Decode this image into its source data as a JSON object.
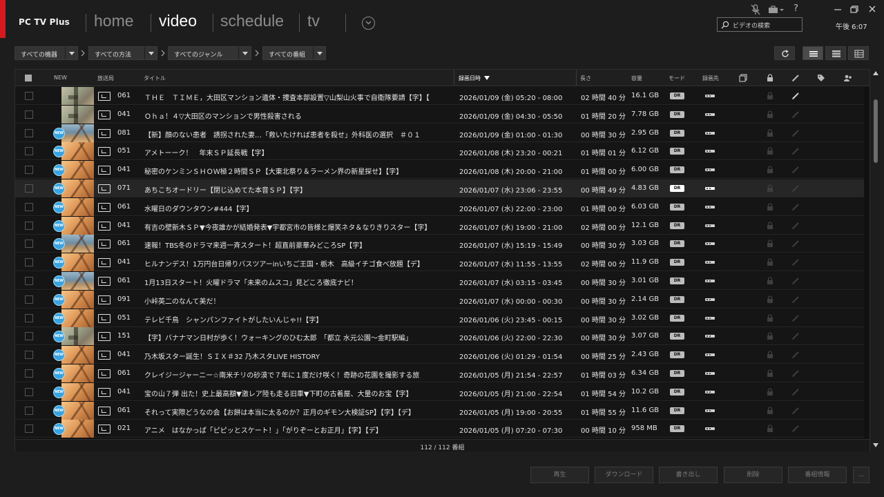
{
  "app": {
    "title": "PC TV Plus"
  },
  "nav": {
    "home": "home",
    "video": "video",
    "schedule": "schedule",
    "tv": "tv",
    "active": "video"
  },
  "window": {
    "help": "?"
  },
  "search": {
    "placeholder": "ビデオの検索"
  },
  "clock": "午後 6:07",
  "filters": {
    "device": "すべての機器",
    "method": "すべての方法",
    "genre": "すべてのジャンル",
    "program": "すべての番組"
  },
  "view": {
    "selected": "list"
  },
  "table": {
    "headers": {
      "new": "NEW",
      "station": "放送局",
      "title": "タイトル",
      "recorded": "録画日時",
      "length": "長さ",
      "size": "容量",
      "mode": "モード",
      "dest": "録画先"
    },
    "sort_column": "録画日時",
    "rows": [
      {
        "new": false,
        "thumb": "map",
        "ch": "061",
        "title": "ＴＨＥ　ＴＩＭＥ，大田区マンション遺体・捜査本部設置▽山梨山火事で自衛隊要請【字】【",
        "date": "2026/01/09 (金) 05:20 - 08:00",
        "length": "02 時間 40 分",
        "size": "16.1 GB",
        "mode": "DR",
        "editable": true
      },
      {
        "new": false,
        "thumb": "map",
        "ch": "041",
        "title": "Ｏｈａ！４▽大田区のマンションで男性殺害される",
        "date": "2026/01/09 (金) 04:30 - 05:50",
        "length": "01 時間 20 分",
        "size": "7.78 GB",
        "mode": "DR",
        "editable": false
      },
      {
        "new": true,
        "thumb": "blue",
        "ch": "081",
        "title": "【新】顔のない患者　誘拐された妻…「救いたければ患者を殺せ」外科医の選択　＃０１",
        "date": "2026/01/09 (金) 01:00 - 01:30",
        "length": "00 時間 30 分",
        "size": "2.95 GB",
        "mode": "DR",
        "editable": false
      },
      {
        "new": true,
        "thumb": "orange",
        "ch": "051",
        "title": "アメトーーク！　年末ＳＰ延長戦【字】",
        "date": "2026/01/08 (木) 23:20 - 00:21",
        "length": "01 時間 01 分",
        "size": "6.12 GB",
        "mode": "DR",
        "editable": false
      },
      {
        "new": true,
        "thumb": "orange",
        "ch": "041",
        "title": "秘密のケンミンＳＨＯＷ極２時間ＳＰ【大東北祭り＆ラーメン界の新星探せ】【字】",
        "date": "2026/01/08 (木) 20:00 - 21:00",
        "length": "01 時間 00 分",
        "size": "6.00 GB",
        "mode": "DR",
        "editable": false
      },
      {
        "new": true,
        "thumb": "orange",
        "ch": "071",
        "title": "あちこちオードリー【閉じ込めてた本音ＳＰ】【字】",
        "date": "2026/01/07 (水) 23:06 - 23:55",
        "length": "00 時間 49 分",
        "size": "4.83 GB",
        "mode": "DR",
        "editable": false,
        "highlight": true
      },
      {
        "new": true,
        "thumb": "orange",
        "ch": "061",
        "title": "水曜日のダウンタウン#444【字】",
        "date": "2026/01/07 (水) 22:00 - 23:00",
        "length": "01 時間 00 分",
        "size": "6.03 GB",
        "mode": "DR",
        "editable": false
      },
      {
        "new": true,
        "thumb": "orange",
        "ch": "041",
        "title": "有吉の壁新木ＳＰ▼今夜誰かが結婚発表▼宇都宮市の皆様と爆笑ネタ＆なりきりスター【字】",
        "date": "2026/01/07 (水) 19:00 - 21:00",
        "length": "02 時間 00 分",
        "size": "12.1 GB",
        "mode": "DR",
        "editable": false
      },
      {
        "new": true,
        "thumb": "blue",
        "ch": "061",
        "title": "速報！TBS冬のドラマ来週一斉スタート！超直前豪華みどころSP【字】",
        "date": "2026/01/07 (水) 15:19 - 15:49",
        "length": "00 時間 30 分",
        "size": "3.03 GB",
        "mode": "DR",
        "editable": false
      },
      {
        "new": true,
        "thumb": "orange",
        "ch": "041",
        "title": "ヒルナンデス！1万円台日帰りバスツアーinいちご王国・栃木　高級イチゴ食べ放題【デ】",
        "date": "2026/01/07 (水) 11:55 - 13:55",
        "length": "02 時間 00 分",
        "size": "11.9 GB",
        "mode": "DR",
        "editable": false
      },
      {
        "new": true,
        "thumb": "blue",
        "ch": "061",
        "title": "1月13日スタート！火曜ドラマ「未来のムスコ」見どころ徹底ナビ！",
        "date": "2026/01/07 (水) 03:15 - 03:45",
        "length": "00 時間 30 分",
        "size": "3.01 GB",
        "mode": "DR",
        "editable": false
      },
      {
        "new": true,
        "thumb": "orange",
        "ch": "091",
        "title": "小峠英二のなんて美だ！",
        "date": "2026/01/07 (水) 00:00 - 00:30",
        "length": "00 時間 30 分",
        "size": "2.14 GB",
        "mode": "DR",
        "editable": false
      },
      {
        "new": true,
        "thumb": "orange",
        "ch": "051",
        "title": "テレビ千鳥　シャンパンファイトがしたいんじゃ!!【字】",
        "date": "2026/01/06 (火) 23:45 - 00:15",
        "length": "00 時間 30 分",
        "size": "3.02 GB",
        "mode": "DR",
        "editable": false
      },
      {
        "new": true,
        "thumb": "map",
        "ch": "151",
        "title": "【字】バナナマン日村が歩く！ウォーキングのひむ太郎　「都立 水元公園～金町駅編」",
        "date": "2026/01/06 (火) 22:00 - 22:30",
        "length": "00 時間 30 分",
        "size": "3.07 GB",
        "mode": "DR",
        "editable": false
      },
      {
        "new": true,
        "thumb": "orange",
        "ch": "041",
        "title": "乃木坂スター誕生！ＳＩＸ＃32 乃木スタLIVE HISTORY",
        "date": "2026/01/06 (火) 01:29 - 01:54",
        "length": "00 時間 25 分",
        "size": "2.43 GB",
        "mode": "DR",
        "editable": false
      },
      {
        "new": true,
        "thumb": "orange",
        "ch": "061",
        "title": "クレイジージャーニー☆南米チリの砂漠で７年に１度だけ咲く！奇跡の花園を撮影する旅",
        "date": "2026/01/05 (月) 21:54 - 22:57",
        "length": "01 時間 03 分",
        "size": "6.34 GB",
        "mode": "DR",
        "editable": false
      },
      {
        "new": true,
        "thumb": "orange",
        "ch": "041",
        "title": "宝の山７弾 出た！史上最高額▼激レア陸も走る旧車▼下町の古着屋、大量のお宝【字】",
        "date": "2026/01/05 (月) 21:00 - 22:54",
        "length": "01 時間 54 分",
        "size": "10.2 GB",
        "mode": "DR",
        "editable": false
      },
      {
        "new": true,
        "thumb": "orange",
        "ch": "061",
        "title": "それって実際どうなの会【お餅は本当に太るのか？正月のギモン大検証SP】【字】【デ】",
        "date": "2026/01/05 (月) 19:00 - 20:55",
        "length": "01 時間 55 分",
        "size": "11.6 GB",
        "mode": "DR",
        "editable": false
      },
      {
        "new": true,
        "thumb": "orange",
        "ch": "021",
        "title": "アニメ　はなかっぱ「ピピッとスケート！」「がりぞーとお正月」【字】【デ】",
        "date": "2026/01/05 (月) 07:20 - 07:30",
        "length": "00 時間 10 分",
        "size": "958 MB",
        "mode": "DR",
        "editable": false
      }
    ],
    "count": "112 / 112 番組"
  },
  "actions": {
    "play": "再生",
    "download": "ダウンロード",
    "export": "書き出し",
    "delete": "削除",
    "info": "番組情報",
    "more": "…"
  }
}
